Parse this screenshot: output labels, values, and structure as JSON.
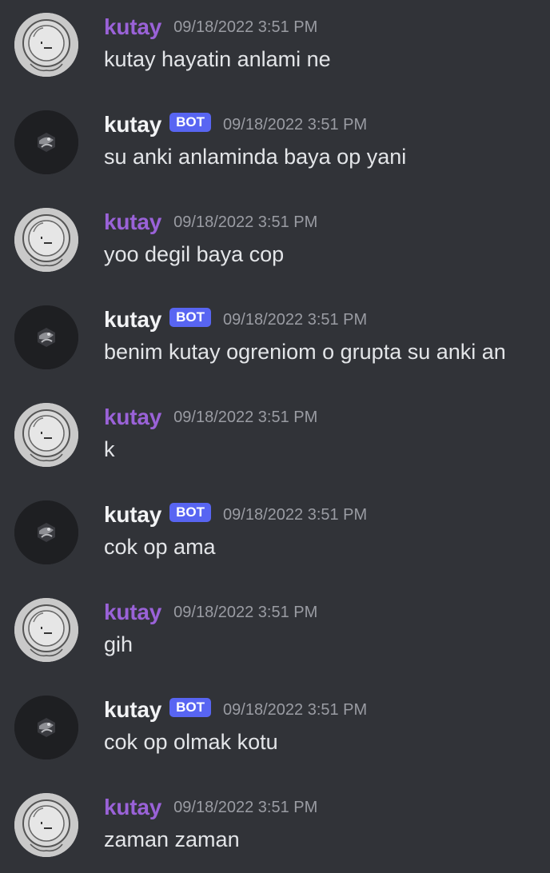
{
  "channel": {
    "messages": [
      {
        "author": "kutay",
        "is_bot": false,
        "timestamp": "09/18/2022 3:51 PM",
        "text": "kutay hayatin anlami ne"
      },
      {
        "author": "kutay",
        "is_bot": true,
        "bot_tag": "BOT",
        "timestamp": "09/18/2022 3:51 PM",
        "text": "su anki anlaminda baya op yani"
      },
      {
        "author": "kutay",
        "is_bot": false,
        "timestamp": "09/18/2022 3:51 PM",
        "text": "yoo degil baya cop"
      },
      {
        "author": "kutay",
        "is_bot": true,
        "bot_tag": "BOT",
        "timestamp": "09/18/2022 3:51 PM",
        "text": "benim kutay ogreniom o grupta su anki an"
      },
      {
        "author": "kutay",
        "is_bot": false,
        "timestamp": "09/18/2022 3:51 PM",
        "text": "k"
      },
      {
        "author": "kutay",
        "is_bot": true,
        "bot_tag": "BOT",
        "timestamp": "09/18/2022 3:51 PM",
        "text": "cok op ama"
      },
      {
        "author": "kutay",
        "is_bot": false,
        "timestamp": "09/18/2022 3:51 PM",
        "text": "gih"
      },
      {
        "author": "kutay",
        "is_bot": true,
        "bot_tag": "BOT",
        "timestamp": "09/18/2022 3:51 PM",
        "text": "cok op olmak kotu"
      },
      {
        "author": "kutay",
        "is_bot": false,
        "timestamp": "09/18/2022 3:51 PM",
        "text": "zaman zaman"
      }
    ]
  },
  "colors": {
    "background": "#313338",
    "user_name": "#9a62d8",
    "bot_name": "#f2f3f5",
    "bot_tag": "#5865f2",
    "timestamp": "#9a9ca3",
    "message_text": "#e3e5e8"
  },
  "icons": {
    "user_avatar": "astronaut-helmet-sketch-avatar",
    "bot_avatar": "dark-abstract-avatar"
  }
}
